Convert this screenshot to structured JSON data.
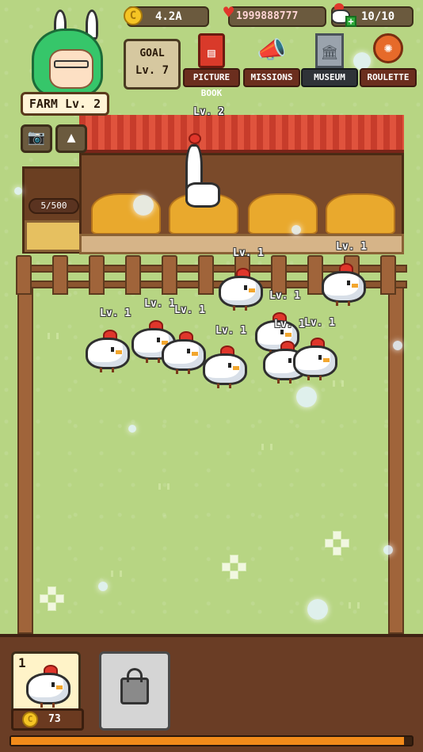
{
  "hud": {
    "coins": "4.2A",
    "hearts": "1999888777",
    "chicken_capacity": "10/10"
  },
  "farm": {
    "label": "FARM",
    "level": "Lv. 2"
  },
  "goal": {
    "title": "GOAL",
    "level": "Lv. 7"
  },
  "menu": [
    {
      "label": "PICTURE BOOK",
      "icon": "book-icon"
    },
    {
      "label": "MISSIONS",
      "icon": "megaphone-icon"
    },
    {
      "label": "MUSEUM",
      "icon": "museum-icon"
    },
    {
      "label": "ROULETTE",
      "icon": "roulette-icon"
    }
  ],
  "tools": {
    "camera": "camera-icon",
    "hat": "hat-icon"
  },
  "storage": {
    "eggs": "5/500"
  },
  "chickens": [
    {
      "level": "Lv. 2",
      "kind": "tall"
    },
    {
      "level": "Lv. 1"
    },
    {
      "level": "Lv. 1"
    },
    {
      "level": "Lv. 1"
    },
    {
      "level": "Lv. 1"
    },
    {
      "level": "Lv. 1"
    },
    {
      "level": "Lv. 1"
    },
    {
      "level": "Lv. 1"
    },
    {
      "level": "Lv. 1"
    },
    {
      "level": "Lv. 1"
    }
  ],
  "shop": {
    "slot_count": "1",
    "price": "73",
    "locked_slot": "lock-icon"
  },
  "progress": {
    "fraction": 0.98
  },
  "colors": {
    "accent": "#f28b1a",
    "roof": "#c73c2b",
    "grass": "#b7d583"
  }
}
